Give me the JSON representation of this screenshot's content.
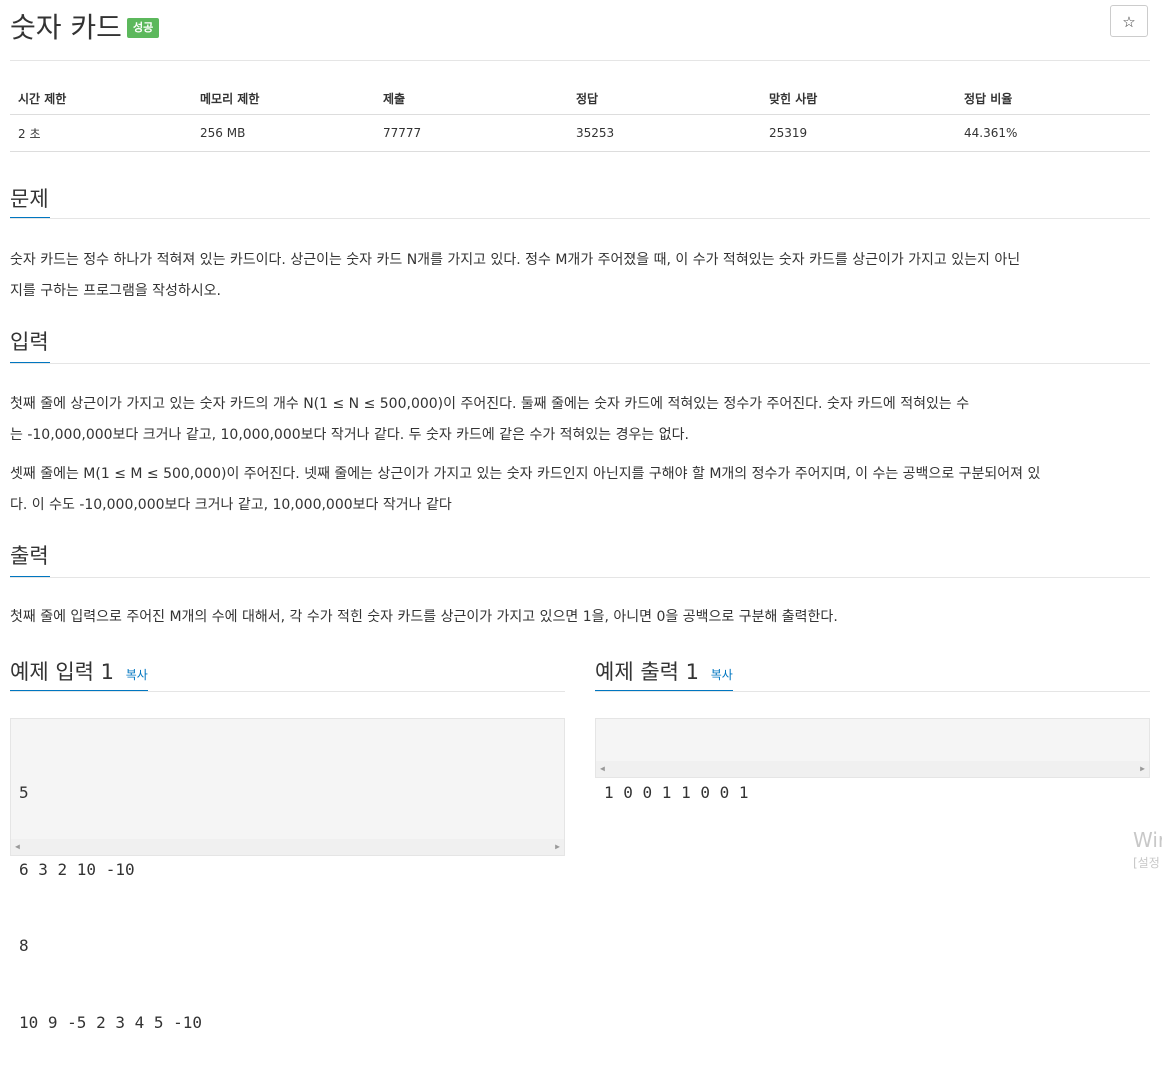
{
  "problem": {
    "title": "숫자 카드",
    "status_badge": "성공",
    "star_icon": "☆"
  },
  "stats": {
    "headers": [
      "시간 제한",
      "메모리 제한",
      "제출",
      "정답",
      "맞힌 사람",
      "정답 비율"
    ],
    "values": [
      "2 초",
      "256 MB",
      "77777",
      "35253",
      "25319",
      "44.361%"
    ]
  },
  "sections": {
    "problem": {
      "title": "문제",
      "lines": [
        "숫자 카드는 정수 하나가 적혀져 있는 카드이다. 상근이는 숫자 카드 N개를 가지고 있다. 정수 M개가 주어졌을 때, 이 수가 적혀있는 숫자 카드를 상근이가 가지고 있는지 아닌",
        "지를 구하는 프로그램을 작성하시오."
      ]
    },
    "input": {
      "title": "입력",
      "lines": [
        "첫째 줄에 상근이가 가지고 있는 숫자 카드의 개수 N(1 ≤ N ≤ 500,000)이 주어진다. 둘째 줄에는 숫자 카드에 적혀있는 정수가 주어진다. 숫자 카드에 적혀있는 수",
        "는 -10,000,000보다 크거나 같고, 10,000,000보다 작거나 같다. 두 숫자 카드에 같은 수가 적혀있는 경우는 없다.",
        "셋째 줄에는 M(1 ≤ M ≤ 500,000)이 주어진다. 넷째 줄에는 상근이가 가지고 있는 숫자 카드인지 아닌지를 구해야 할 M개의 정수가 주어지며, 이 수는 공백으로 구분되어져 있",
        "다. 이 수도 -10,000,000보다 크거나 같고, 10,000,000보다 작거나 같다"
      ]
    },
    "output": {
      "title": "출력",
      "lines": [
        "첫째 줄에 입력으로 주어진 M개의 수에 대해서, 각 수가 적힌 숫자 카드를 상근이가 가지고 있으면 1을, 아니면 0을 공백으로 구분해 출력한다."
      ]
    }
  },
  "examples": {
    "input": {
      "title": "예제 입력 1",
      "copy_label": "복사",
      "lines": [
        "5",
        "6 3 2 10 -10",
        "8",
        "10 9 -5 2 3 4 5 -10"
      ]
    },
    "output": {
      "title": "예제 출력 1",
      "copy_label": "복사",
      "lines": [
        "1 0 0 1 1 0 0 1"
      ]
    }
  },
  "scrollbar": {
    "left_arrow": "◀",
    "right_arrow": "▶"
  },
  "os_watermark": {
    "line1": "Wir",
    "line2": "[설정"
  },
  "colors": {
    "accent": "#0076c0",
    "badge": "#5cb85c",
    "code_bg": "#f5f5f5"
  }
}
